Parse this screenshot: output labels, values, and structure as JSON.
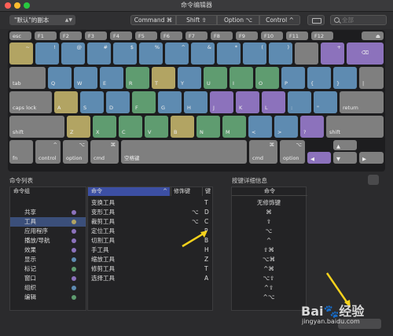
{
  "window": {
    "title": "命令编辑器"
  },
  "toolbar": {
    "preset": "\"默认\"的副本",
    "mods": [
      "Command ⌘",
      "Shift ⇧",
      "Option ⌥",
      "Control ^"
    ],
    "search_placeholder": "全部"
  },
  "keyboard": {
    "row0": [
      "esc",
      "F1",
      "F2",
      "F3",
      "F4",
      "F5",
      "F6",
      "F7",
      "F8",
      "F9",
      "F10",
      "F11",
      "F12",
      "⏏"
    ],
    "row1": [
      "~",
      "!",
      "@",
      "#",
      "$",
      "%",
      "^",
      "&",
      "*",
      "(",
      ")",
      "",
      "+",
      "⌫"
    ],
    "row2": [
      "tab",
      "Q",
      "W",
      "E",
      "R",
      "T",
      "Y",
      "U",
      "I",
      "O",
      "P",
      "{",
      "}",
      "|"
    ],
    "row3": [
      "caps lock",
      "A",
      "S",
      "D",
      "F",
      "G",
      "H",
      "J",
      "K",
      "L",
      ":",
      "\"",
      "return"
    ],
    "row4": [
      "shift",
      "Z",
      "X",
      "C",
      "V",
      "B",
      "N",
      "M",
      "<",
      ">",
      "?",
      "shift"
    ],
    "row5": [
      "fn",
      "control",
      "option",
      "cmd",
      "空格键",
      "cmd",
      "option",
      "◀",
      "▲",
      "▶",
      "▼"
    ]
  },
  "labels": {
    "command_list": "命令列表",
    "key_detail": "按键详细信息"
  },
  "groups": {
    "header": "命令组",
    "items": [
      {
        "label": "共享",
        "color": "#8c72bc"
      },
      {
        "label": "工具",
        "color": "#b2a463"
      },
      {
        "label": "应用程序",
        "color": "#8c72bc"
      },
      {
        "label": "播放/导航",
        "color": "#8c72bc"
      },
      {
        "label": "效果",
        "color": "#8c72bc"
      },
      {
        "label": "显示",
        "color": "#5e8bb1"
      },
      {
        "label": "标记",
        "color": "#5f9c70"
      },
      {
        "label": "窗口",
        "color": "#8c72bc"
      },
      {
        "label": "组织",
        "color": "#5e8bb1"
      },
      {
        "label": "编辑",
        "color": "#5f9c70"
      }
    ]
  },
  "commands": {
    "headers": [
      "命令",
      "修饰键",
      "键"
    ],
    "rows": [
      {
        "name": "变换工具",
        "mod": "",
        "key": "T"
      },
      {
        "name": "变形工具",
        "mod": "⌥",
        "key": "D"
      },
      {
        "name": "裁剪工具",
        "mod": "⌥",
        "key": "C"
      },
      {
        "name": "定位工具",
        "mod": "",
        "key": "P"
      },
      {
        "name": "切割工具",
        "mod": "",
        "key": "B"
      },
      {
        "name": "手工具",
        "mod": "",
        "key": "H"
      },
      {
        "name": "缩放工具",
        "mod": "",
        "key": "Z"
      },
      {
        "name": "修剪工具",
        "mod": "",
        "key": "T"
      },
      {
        "name": "选择工具",
        "mod": "",
        "key": "A"
      }
    ]
  },
  "detail": {
    "header": "命令",
    "mods": [
      "无修饰键",
      "⌘",
      "⇧",
      "⌥",
      "^",
      "⇧⌘",
      "⌥⌘",
      "^⌘",
      "⌥⇧",
      "^⇧",
      "^⌥"
    ]
  },
  "watermark": {
    "brand": "Bai",
    "brand2": "经验",
    "url": "jingyan.baidu.com"
  }
}
